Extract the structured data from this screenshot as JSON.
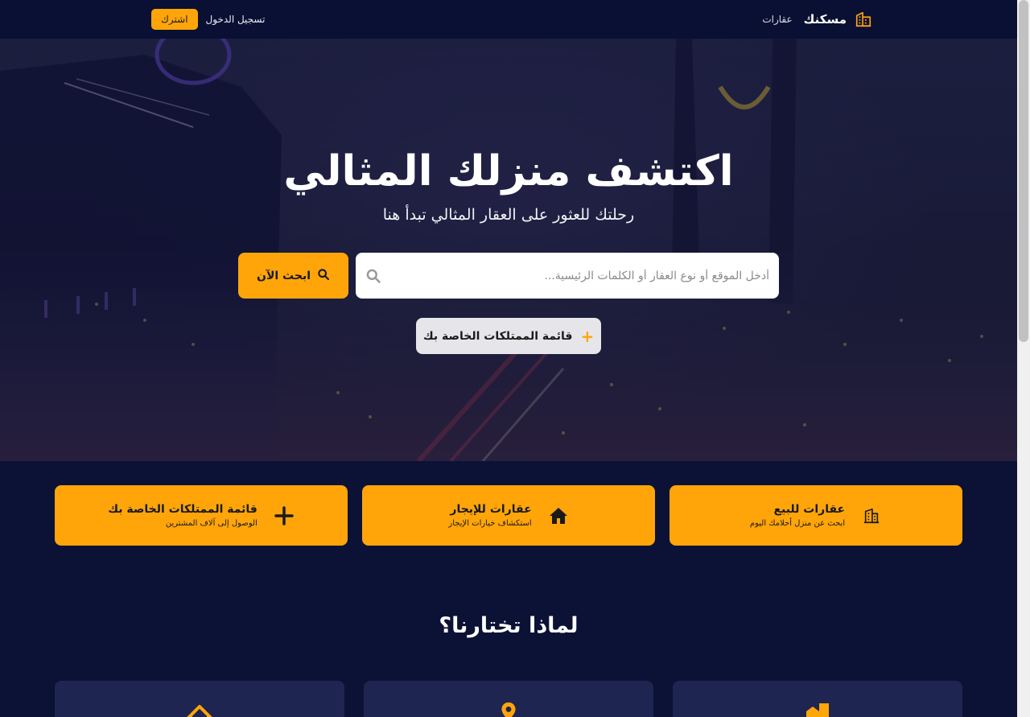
{
  "header": {
    "brand_name": "مسكنك",
    "nav_properties": "عقارات",
    "login_label": "تسجيل الدخول",
    "subscribe_label": "اشترك"
  },
  "hero": {
    "title": "اكتشف منزلك المثالي",
    "subtitle": "رحلتك للعثور على العقار المثالي تبدأ هنا",
    "search_placeholder": "أدخل الموقع أو نوع العقار أو الكلمات الرئيسية...",
    "search_button": "ابحث الآن",
    "list_button": "قائمة الممتلكات الخاصة بك"
  },
  "cards": [
    {
      "icon": "building-icon",
      "title": "عقارات للبيع",
      "desc": "ابحث عن منزل أحلامك اليوم"
    },
    {
      "icon": "home-icon",
      "title": "عقارات للإيجار",
      "desc": "استكشاف خيارات الإيجار"
    },
    {
      "icon": "plus-icon",
      "title": "قائمة الممتلكات الخاصة بك",
      "desc": "الوصول إلى آلاف المشترين"
    }
  ],
  "why": {
    "title": "لماذا تختارنا؟",
    "features": [
      {
        "icon": "city-icon"
      },
      {
        "icon": "location-pin-icon"
      },
      {
        "icon": "home-icon"
      }
    ]
  },
  "colors": {
    "accent": "#ffa50a",
    "page_bg": "#0c1236",
    "header_bg": "#0a1033",
    "feature_card_bg": "#1d2550"
  }
}
